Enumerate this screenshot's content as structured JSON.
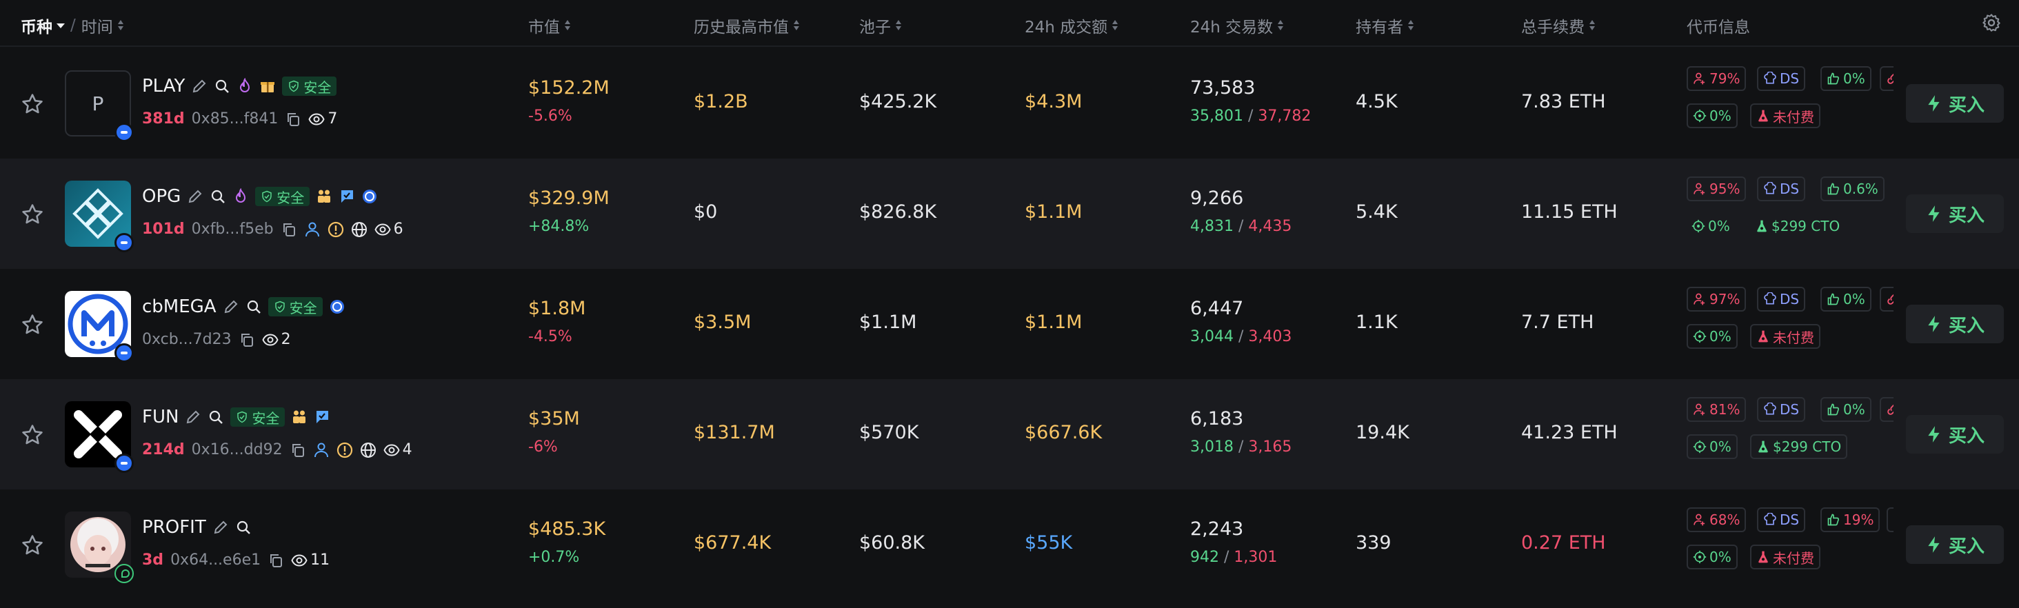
{
  "header": {
    "coin_label": "币种",
    "time_label": "时间",
    "columns": {
      "market_cap": "市值",
      "ath_market_cap": "历史最高市值",
      "pool": "池子",
      "volume_24h": "24h 成交额",
      "txns_24h": "24h 交易数",
      "holders": "持有者",
      "total_fees": "总手续费",
      "token_info": "代币信息"
    }
  },
  "buy_label": "买入",
  "safe_label": "安全",
  "colors": {
    "background": "#111214",
    "row_alt": "#1a1b1f",
    "red": "#f0506e",
    "green": "#59d68e",
    "yellow": "#f6c365",
    "blue": "#59a8ff"
  },
  "rows": [
    {
      "symbol": "PLAY",
      "avatar_letter": "P",
      "age": "381d",
      "address": "0x85...f841",
      "views": "7",
      "market_cap": "$152.2M",
      "market_cap_change": "-5.6%",
      "ath": "$1.2B",
      "pool": "$425.2K",
      "volume": "$4.3M",
      "txns": "73,583",
      "buys": "35,801",
      "sells": "37,782",
      "holders": "4.5K",
      "fees": "7.83 ETH",
      "info": {
        "top10": "79%",
        "ds": "DS",
        "dev": "0%",
        "snipers": "0%",
        "paid": "未付费"
      }
    },
    {
      "symbol": "OPG",
      "age": "101d",
      "address": "0xfb...f5eb",
      "views": "6",
      "market_cap": "$329.9M",
      "market_cap_change": "+84.8%",
      "ath": "$0",
      "pool": "$826.8K",
      "volume": "$1.1M",
      "txns": "9,266",
      "buys": "4,831",
      "sells": "4,435",
      "holders": "5.4K",
      "fees": "11.15 ETH",
      "info": {
        "top10": "95%",
        "ds": "DS",
        "dev": "0.6%",
        "snipers": "0%",
        "paid": "$299 CTO"
      }
    },
    {
      "symbol": "cbMEGA",
      "age": "",
      "address": "0xcb...7d23",
      "views": "2",
      "market_cap": "$1.8M",
      "market_cap_change": "-4.5%",
      "ath": "$3.5M",
      "pool": "$1.1M",
      "volume": "$1.1M",
      "txns": "6,447",
      "buys": "3,044",
      "sells": "3,403",
      "holders": "1.1K",
      "fees": "7.7 ETH",
      "info": {
        "top10": "97%",
        "ds": "DS",
        "dev": "0%",
        "snipers": "0%",
        "paid": "未付费"
      }
    },
    {
      "symbol": "FUN",
      "age": "214d",
      "address": "0x16...dd92",
      "views": "4",
      "market_cap": "$35M",
      "market_cap_change": "-6%",
      "ath": "$131.7M",
      "pool": "$570K",
      "volume": "$667.6K",
      "txns": "6,183",
      "buys": "3,018",
      "sells": "3,165",
      "holders": "19.4K",
      "fees": "41.23 ETH",
      "info": {
        "top10": "81%",
        "ds": "DS",
        "dev": "0%",
        "snipers": "0%",
        "paid": "$299 CTO"
      }
    },
    {
      "symbol": "PROFIT",
      "age": "3d",
      "address": "0x64...e6e1",
      "views": "11",
      "market_cap": "$485.3K",
      "market_cap_change": "+0.7%",
      "ath": "$677.4K",
      "pool": "$60.8K",
      "volume": "$55K",
      "txns": "2,243",
      "buys": "942",
      "sells": "1,301",
      "holders": "339",
      "fees": "0.27 ETH",
      "info": {
        "top10": "68%",
        "ds": "DS",
        "dev": "19%",
        "snipers": "0%",
        "paid": "未付费"
      }
    }
  ]
}
